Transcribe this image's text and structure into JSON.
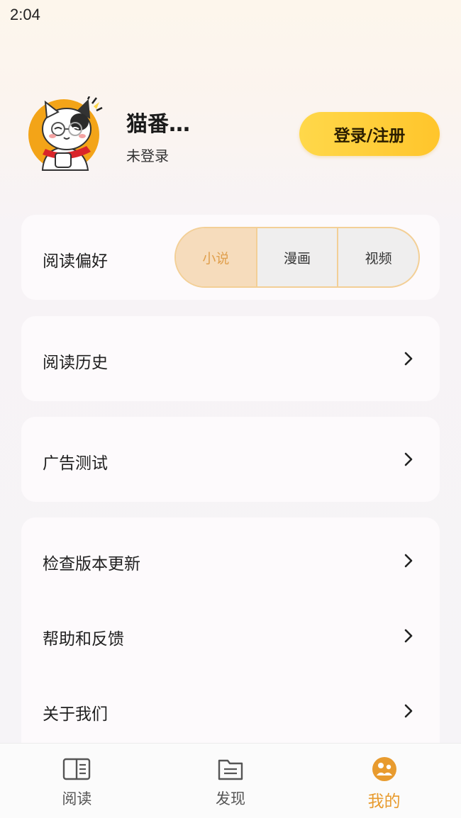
{
  "status_bar": {
    "time": "2:04"
  },
  "profile": {
    "username": "猫番…",
    "login_status": "未登录",
    "login_button": "登录/注册"
  },
  "reading_preference": {
    "label": "阅读偏好",
    "options": [
      "小说",
      "漫画",
      "视频"
    ],
    "selected": "小说"
  },
  "menu": {
    "history": "阅读历史",
    "ad_test": "广告测试",
    "check_update": "检查版本更新",
    "help_feedback": "帮助和反馈",
    "about_us": "关于我们"
  },
  "bottom_nav": {
    "items": [
      {
        "label": "阅读",
        "icon": "book-open-icon"
      },
      {
        "label": "发现",
        "icon": "folder-icon"
      },
      {
        "label": "我的",
        "icon": "profile-face-icon"
      }
    ],
    "active": "我的"
  },
  "colors": {
    "accent": "#e89b2e",
    "button_yellow": "#ffd23d",
    "segment_active_bg": "#f6dcbc"
  }
}
